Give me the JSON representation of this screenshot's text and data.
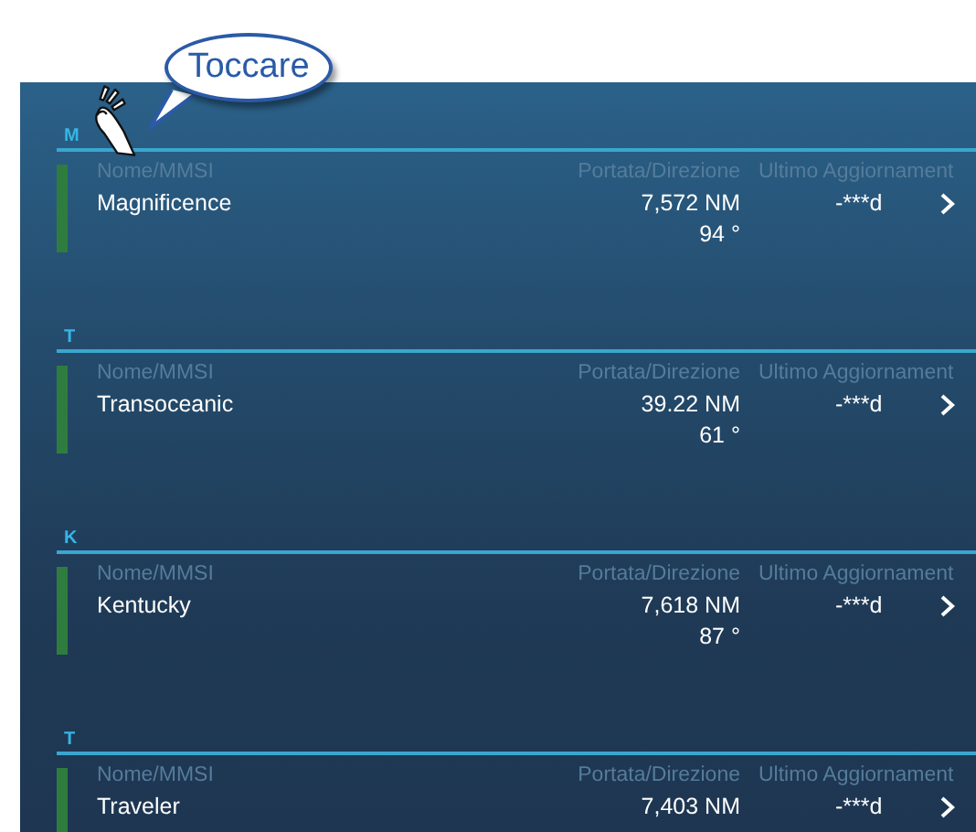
{
  "callout": {
    "text": "Toccare"
  },
  "groups": [
    {
      "letter": "M",
      "vessel": {
        "name_label": "Nome/MMSI",
        "name": "Magnificence",
        "range_label": "Portata/Direzione",
        "range": "7,572 NM",
        "bearing": "94 °",
        "update_label": "Ultimo Aggiornament",
        "update": "-***d"
      }
    },
    {
      "letter": "T",
      "vessel": {
        "name_label": "Nome/MMSI",
        "name": "Transoceanic",
        "range_label": "Portata/Direzione",
        "range": "39.22 NM",
        "bearing": "61 °",
        "update_label": "Ultimo Aggiornament",
        "update": "-***d"
      }
    },
    {
      "letter": "K",
      "vessel": {
        "name_label": "Nome/MMSI",
        "name": "Kentucky",
        "range_label": "Portata/Direzione",
        "range": "7,618 NM",
        "bearing": "87 °",
        "update_label": "Ultimo Aggiornament",
        "update": "-***d"
      }
    },
    {
      "letter": "T",
      "vessel": {
        "name_label": "Nome/MMSI",
        "name": "Traveler",
        "range_label": "Portata/Direzione",
        "range": "7,403 NM",
        "update_label": "Ultimo Aggiornament",
        "update": "-***d"
      }
    }
  ]
}
